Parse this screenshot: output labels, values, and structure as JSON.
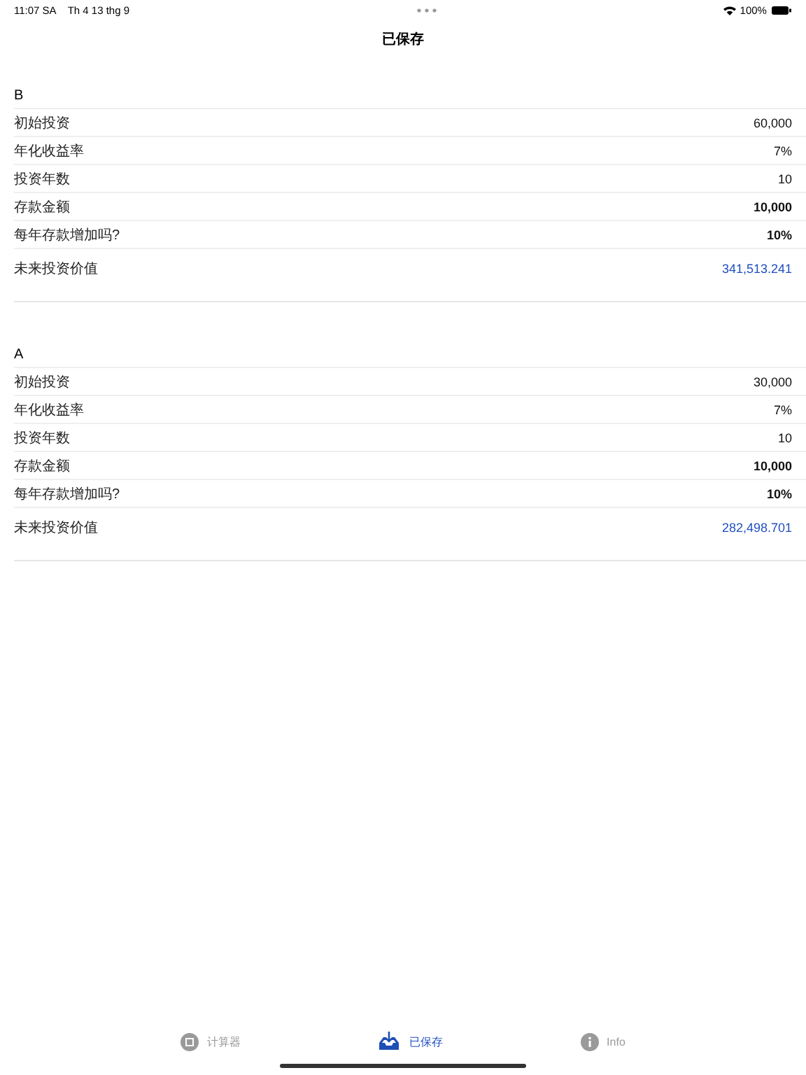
{
  "status_bar": {
    "time": "11:07 SA",
    "date": "Th 4 13 thg 9",
    "battery": "100%"
  },
  "title": "已保存",
  "sections": [
    {
      "name": "B",
      "rows": [
        {
          "label": "初始投资",
          "value": "60,000",
          "kind": "plain"
        },
        {
          "label": "年化收益率",
          "value": "7%",
          "kind": "plain"
        },
        {
          "label": "投资年数",
          "value": "10",
          "kind": "plain"
        },
        {
          "label": "存款金额",
          "value": "10,000",
          "kind": "bold"
        },
        {
          "label": "每年存款增加吗?",
          "value": "10%",
          "kind": "bold"
        },
        {
          "label": "未来投资价值",
          "value": "341,513.241",
          "kind": "result"
        }
      ]
    },
    {
      "name": "A",
      "rows": [
        {
          "label": "初始投资",
          "value": "30,000",
          "kind": "plain"
        },
        {
          "label": "年化收益率",
          "value": "7%",
          "kind": "plain"
        },
        {
          "label": "投资年数",
          "value": "10",
          "kind": "plain"
        },
        {
          "label": "存款金额",
          "value": "10,000",
          "kind": "bold"
        },
        {
          "label": "每年存款增加吗?",
          "value": "10%",
          "kind": "bold"
        },
        {
          "label": "未来投资价值",
          "value": "282,498.701",
          "kind": "result"
        }
      ]
    }
  ],
  "tabs": [
    {
      "label": "计算器",
      "kind": "calculator",
      "selected": false
    },
    {
      "label": "已保存",
      "kind": "saved",
      "selected": true
    },
    {
      "label": "Info",
      "kind": "info",
      "selected": false
    }
  ]
}
